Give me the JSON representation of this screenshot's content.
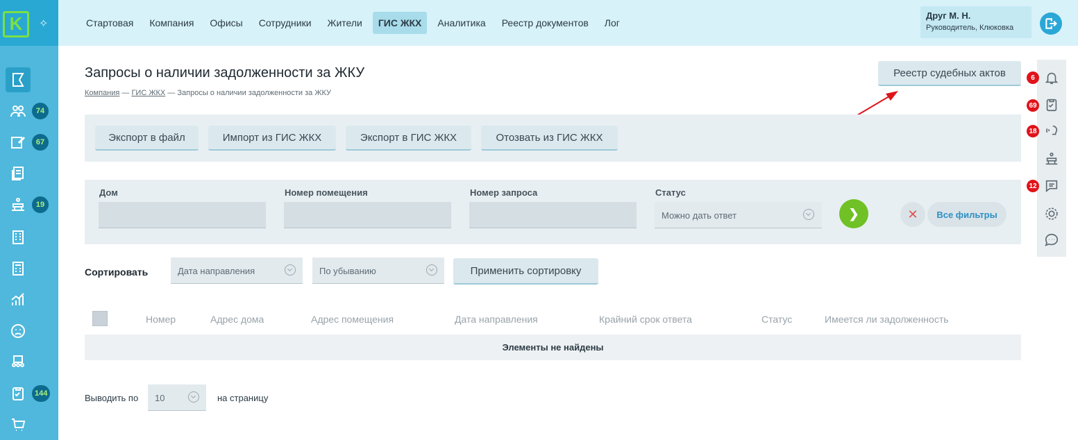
{
  "sidebar": {
    "logo": "K",
    "badges": {
      "residents": "74",
      "edit": "67",
      "staff": "19",
      "tasks": "144"
    }
  },
  "nav": [
    "Стартовая",
    "Компания",
    "Офисы",
    "Сотрудники",
    "Жители",
    "ГИС ЖКХ",
    "Аналитика",
    "Реестр документов",
    "Лог"
  ],
  "user": {
    "name": "Друг М. Н.",
    "role": "Руководитель, Клюковка"
  },
  "page": {
    "title": "Запросы о наличии задолженности за ЖКУ",
    "breadcrumb": {
      "company": "Компания",
      "gis": "ГИС ЖКХ",
      "current": "Запросы о наличии задолженности за ЖКУ",
      "sep": "—"
    },
    "court_acts_button": "Реестр судебных актов"
  },
  "actions": [
    "Экспорт в файл",
    "Импорт из ГИС ЖКХ",
    "Экспорт в ГИС ЖКХ",
    "Отозвать из ГИС ЖКХ"
  ],
  "filters": {
    "house_label": "Дом",
    "room_label": "Номер помещения",
    "request_label": "Номер запроса",
    "status_label": "Статус",
    "status_value": "Можно дать ответ",
    "all_filters": "Все фильтры"
  },
  "sort": {
    "label": "Сортировать",
    "field_value": "Дата направления",
    "order_value": "По убыванию",
    "apply": "Применить сортировку"
  },
  "table": {
    "columns": [
      "Номер",
      "Адрес дома",
      "Адрес помещения",
      "Дата направления",
      "Крайний срок ответа",
      "Статус",
      "Имеется ли задолженность"
    ],
    "empty": "Элементы не найдены"
  },
  "pagination": {
    "prefix": "Выводить по",
    "value": "10",
    "suffix": "на страницу"
  },
  "rail_badges": {
    "bell": "6",
    "tasks": "69",
    "calls": "18",
    "messages": "12"
  },
  "colors": {
    "accent": "#4fb8dc",
    "brand_green": "#7be043",
    "go": "#6fc125",
    "badge_red": "#e0131a"
  }
}
